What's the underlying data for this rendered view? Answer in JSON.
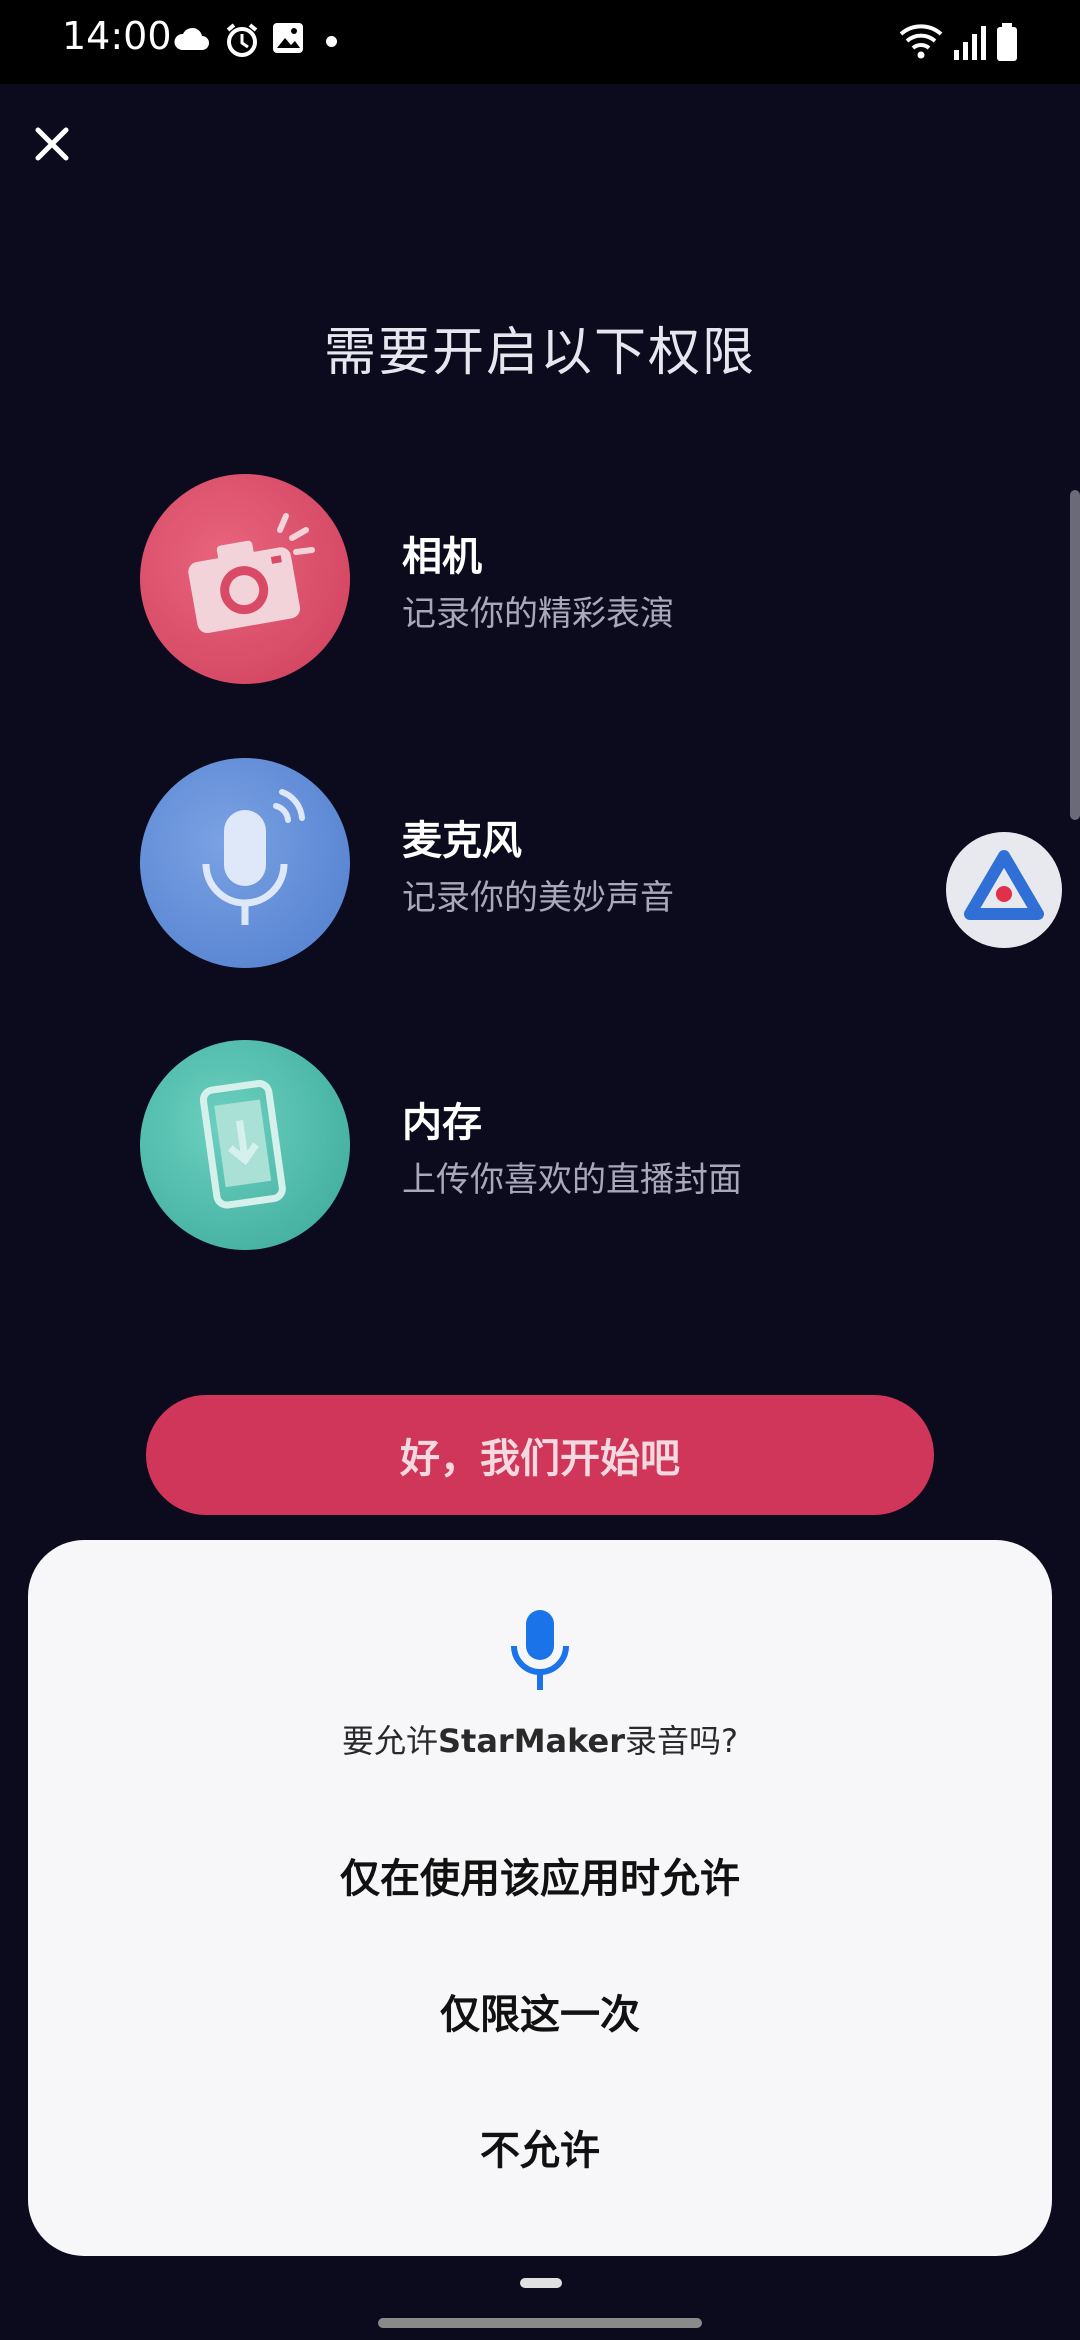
{
  "status_bar": {
    "time": "14:00",
    "icons_left": [
      "cloud-icon",
      "alarm-icon",
      "image-icon",
      "dot-icon"
    ],
    "icons_right": [
      "wifi-icon",
      "signal-icon",
      "battery-icon"
    ]
  },
  "page": {
    "title": "需要开启以下权限",
    "close_icon": "close-icon"
  },
  "permissions": [
    {
      "name": "相机",
      "desc": "记录你的精彩表演",
      "icon": "camera-icon",
      "color": "#d94a66"
    },
    {
      "name": "麦克风",
      "desc": "记录你的美妙声音",
      "icon": "microphone-icon",
      "color": "#5a88d6"
    },
    {
      "name": "内存",
      "desc": "上传你喜欢的直播封面",
      "icon": "phone-download-icon",
      "color": "#44b8a8"
    }
  ],
  "cta": {
    "label": "好，我们开始吧",
    "color": "#d0365a"
  },
  "dialog": {
    "icon": "microphone-icon",
    "question_prefix": "要允许",
    "app_name": "StarMaker",
    "question_suffix": "录音吗?",
    "options": [
      {
        "label": "仅在使用该应用时允许"
      },
      {
        "label": "仅限这一次"
      },
      {
        "label": "不允许"
      }
    ],
    "accent": "#1a73e8"
  }
}
